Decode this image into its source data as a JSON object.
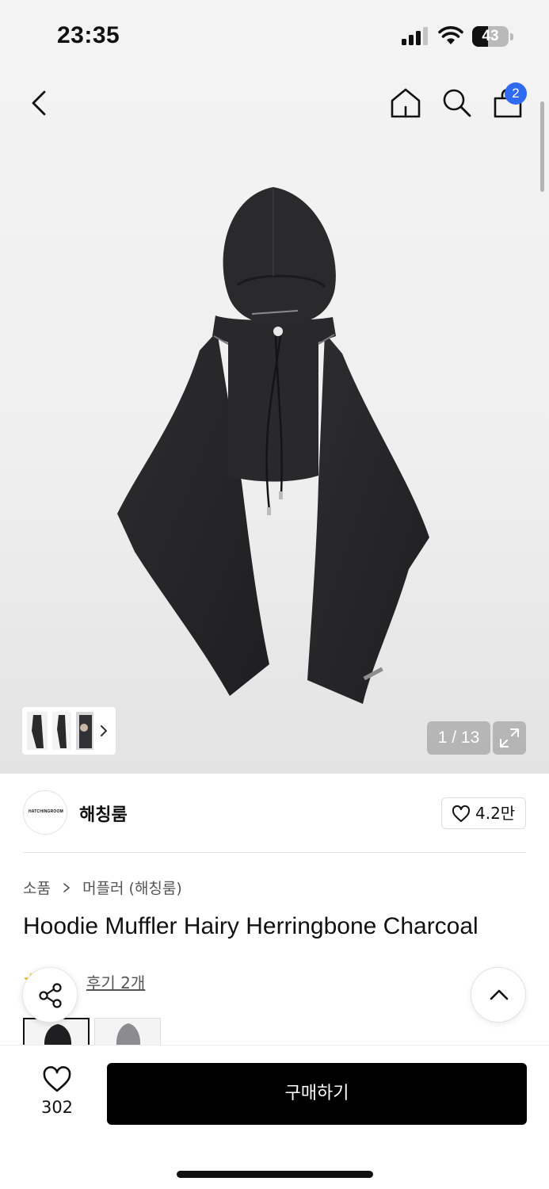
{
  "status_bar": {
    "time": "23:35",
    "battery_level": 43,
    "battery_text": "43",
    "icons": [
      "signal-icon",
      "wifi-icon",
      "battery-icon"
    ]
  },
  "header": {
    "icons": [
      "back-icon",
      "home-icon",
      "search-icon",
      "shopping-bag-icon"
    ],
    "cart_count": "2"
  },
  "gallery": {
    "counter": "1 / 13",
    "thumbnail_strip_icon": "chevron-right-icon",
    "expand_icon": "expand-icon"
  },
  "brand": {
    "logo_text": "HATCHINGROOM",
    "name": "해칭룸",
    "likes": "4.2만"
  },
  "breadcrumb": {
    "category": "소품",
    "subcategory": "머플러 (해칭룸)"
  },
  "product": {
    "title": "Hoodie Muffler Hairy Herringbone Charcoal",
    "review_text": "후기 2개"
  },
  "colors": {
    "accent_blue": "#2f6af2",
    "rating_star": "#f5b400",
    "buy_button": "#000000"
  },
  "bottom_bar": {
    "wish_count": "302",
    "buy_label": "구매하기"
  }
}
